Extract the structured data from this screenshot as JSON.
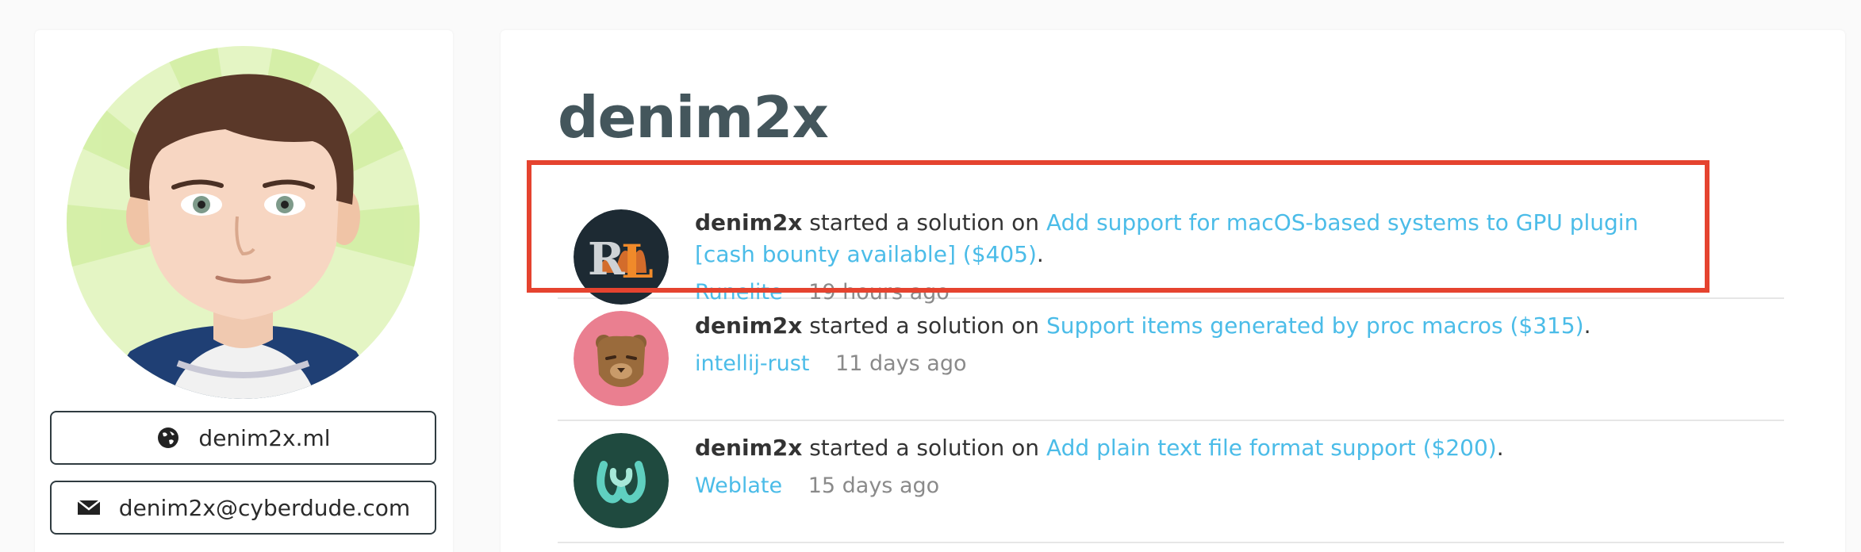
{
  "sidebar": {
    "website": {
      "label": "denim2x.ml",
      "icon": "globe-icon"
    },
    "email": {
      "label": "denim2x@cyberdude.com",
      "icon": "envelope-icon"
    }
  },
  "main": {
    "title": "denim2x",
    "activities": [
      {
        "user": "denim2x",
        "action": "started a solution on",
        "link": "Add support for macOS-based systems to GPU plugin [cash bounty available] ($405)",
        "project": "Runelite",
        "time": "19 hours ago"
      },
      {
        "user": "denim2x",
        "action": "started a solution on",
        "link": "Support items generated by proc macros ($315)",
        "project": "intellij-rust",
        "time": "11 days ago"
      },
      {
        "user": "denim2x",
        "action": "started a solution on",
        "link": "Add plain text file format support ($200)",
        "project": "Weblate",
        "time": "15 days ago"
      }
    ]
  },
  "colors": {
    "link": "#4bbce8",
    "title": "#44565c",
    "highlight": "#e5432f"
  }
}
